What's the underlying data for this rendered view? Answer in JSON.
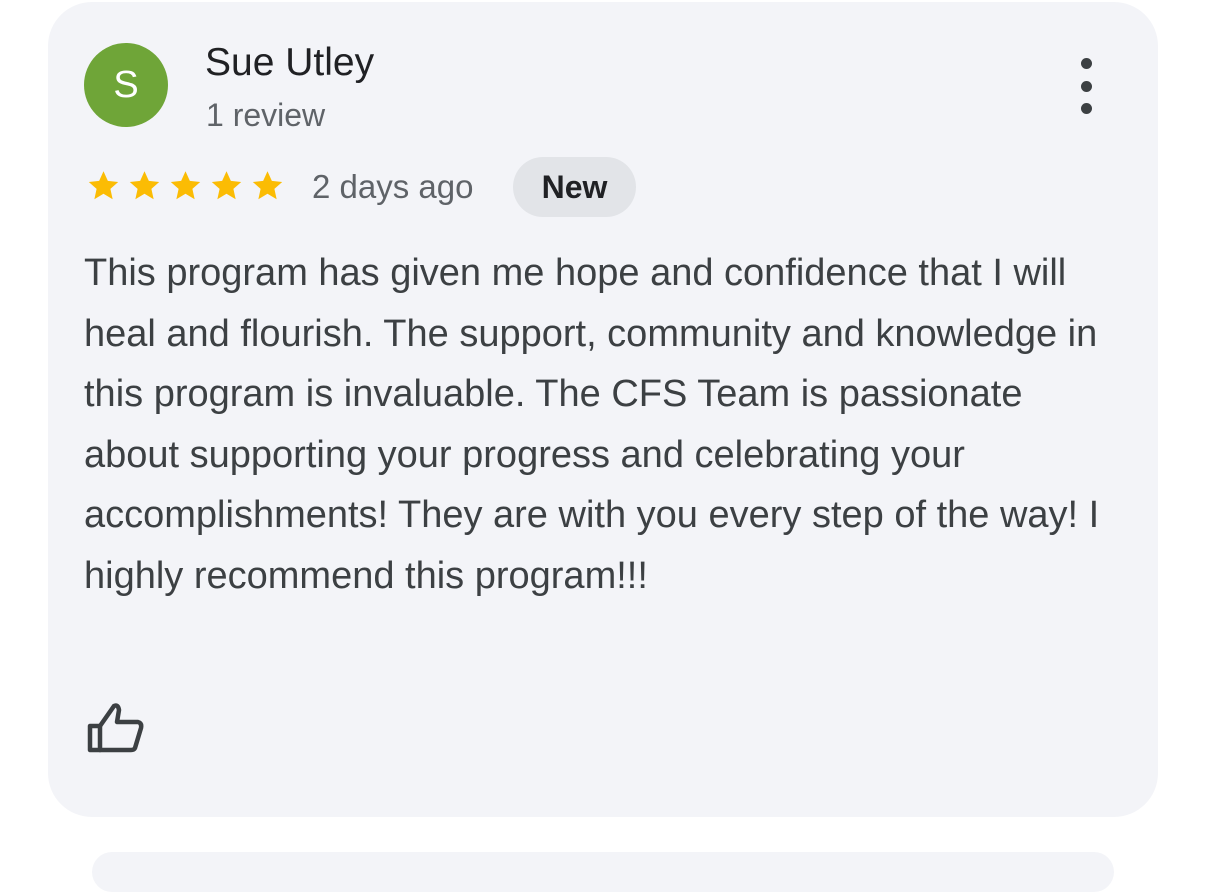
{
  "review": {
    "author": {
      "initial": "S",
      "name": "Sue Utley",
      "review_count": "1 review",
      "avatar_color": "#6fa538"
    },
    "rating": 5,
    "rating_max": 5,
    "star_color": "#fbbc04",
    "date": "2 days ago",
    "badge": "New",
    "text": "This program has given me hope and confidence that I will heal and flourish. The support, community and knowledge in this program is invaluable. The CFS Team is passionate about supporting your progress and celebrating your accomplishments! They are with you every step of the way! I highly recommend this program!!!",
    "icons": {
      "more": "more-vert-icon",
      "like": "thumbs-up-icon",
      "star": "star-icon"
    }
  }
}
